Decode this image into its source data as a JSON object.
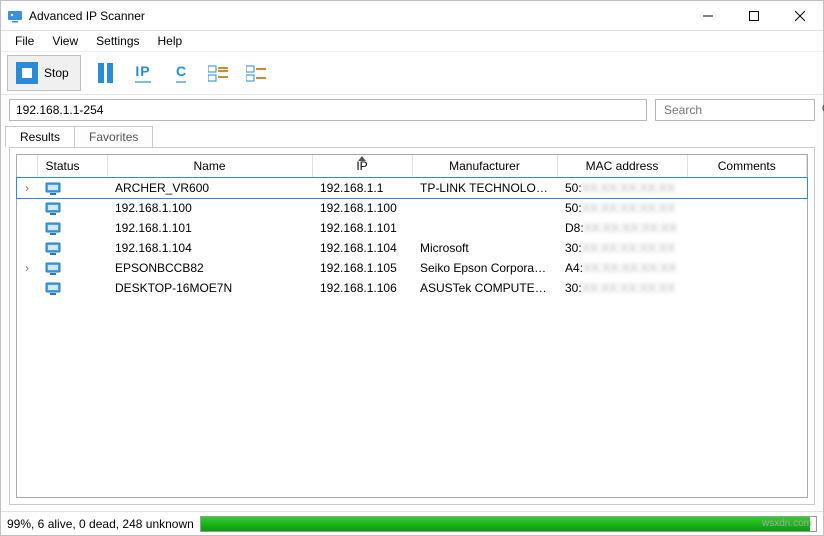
{
  "window": {
    "title": "Advanced IP Scanner"
  },
  "menu": {
    "file": "File",
    "view": "View",
    "settings": "Settings",
    "help": "Help"
  },
  "toolbar": {
    "stop_label": "Stop",
    "ip_label": "IP",
    "c_label": "C"
  },
  "filter": {
    "ip_range": "192.168.1.1-254",
    "search_placeholder": "Search"
  },
  "tabs": {
    "results": "Results",
    "favorites": "Favorites"
  },
  "columns": {
    "status": "Status",
    "name": "Name",
    "ip": "IP",
    "manufacturer": "Manufacturer",
    "mac": "MAC address",
    "comments": "Comments"
  },
  "rows": [
    {
      "expandable": true,
      "name": "ARCHER_VR600",
      "ip": "192.168.1.1",
      "manufacturer": "TP-LINK TECHNOLOG...",
      "mac_prefix": "50:",
      "selected": true
    },
    {
      "expandable": false,
      "name": "192.168.1.100",
      "ip": "192.168.1.100",
      "manufacturer": "",
      "mac_prefix": "50:",
      "selected": false
    },
    {
      "expandable": false,
      "name": "192.168.1.101",
      "ip": "192.168.1.101",
      "manufacturer": "",
      "mac_prefix": "D8:",
      "selected": false
    },
    {
      "expandable": false,
      "name": "192.168.1.104",
      "ip": "192.168.1.104",
      "manufacturer": "Microsoft",
      "mac_prefix": "30:",
      "selected": false
    },
    {
      "expandable": true,
      "name": "EPSONBCCB82",
      "ip": "192.168.1.105",
      "manufacturer": "Seiko Epson Corporati...",
      "mac_prefix": "A4:",
      "selected": false
    },
    {
      "expandable": false,
      "name": "DESKTOP-16MOE7N",
      "ip": "192.168.1.106",
      "manufacturer": "ASUSTek COMPUTER I...",
      "mac_prefix": "30:",
      "selected": false
    }
  ],
  "status": {
    "text": "99%, 6 alive, 0 dead, 248 unknown",
    "progress_pct": 99
  },
  "watermark": "wsxdn.com"
}
